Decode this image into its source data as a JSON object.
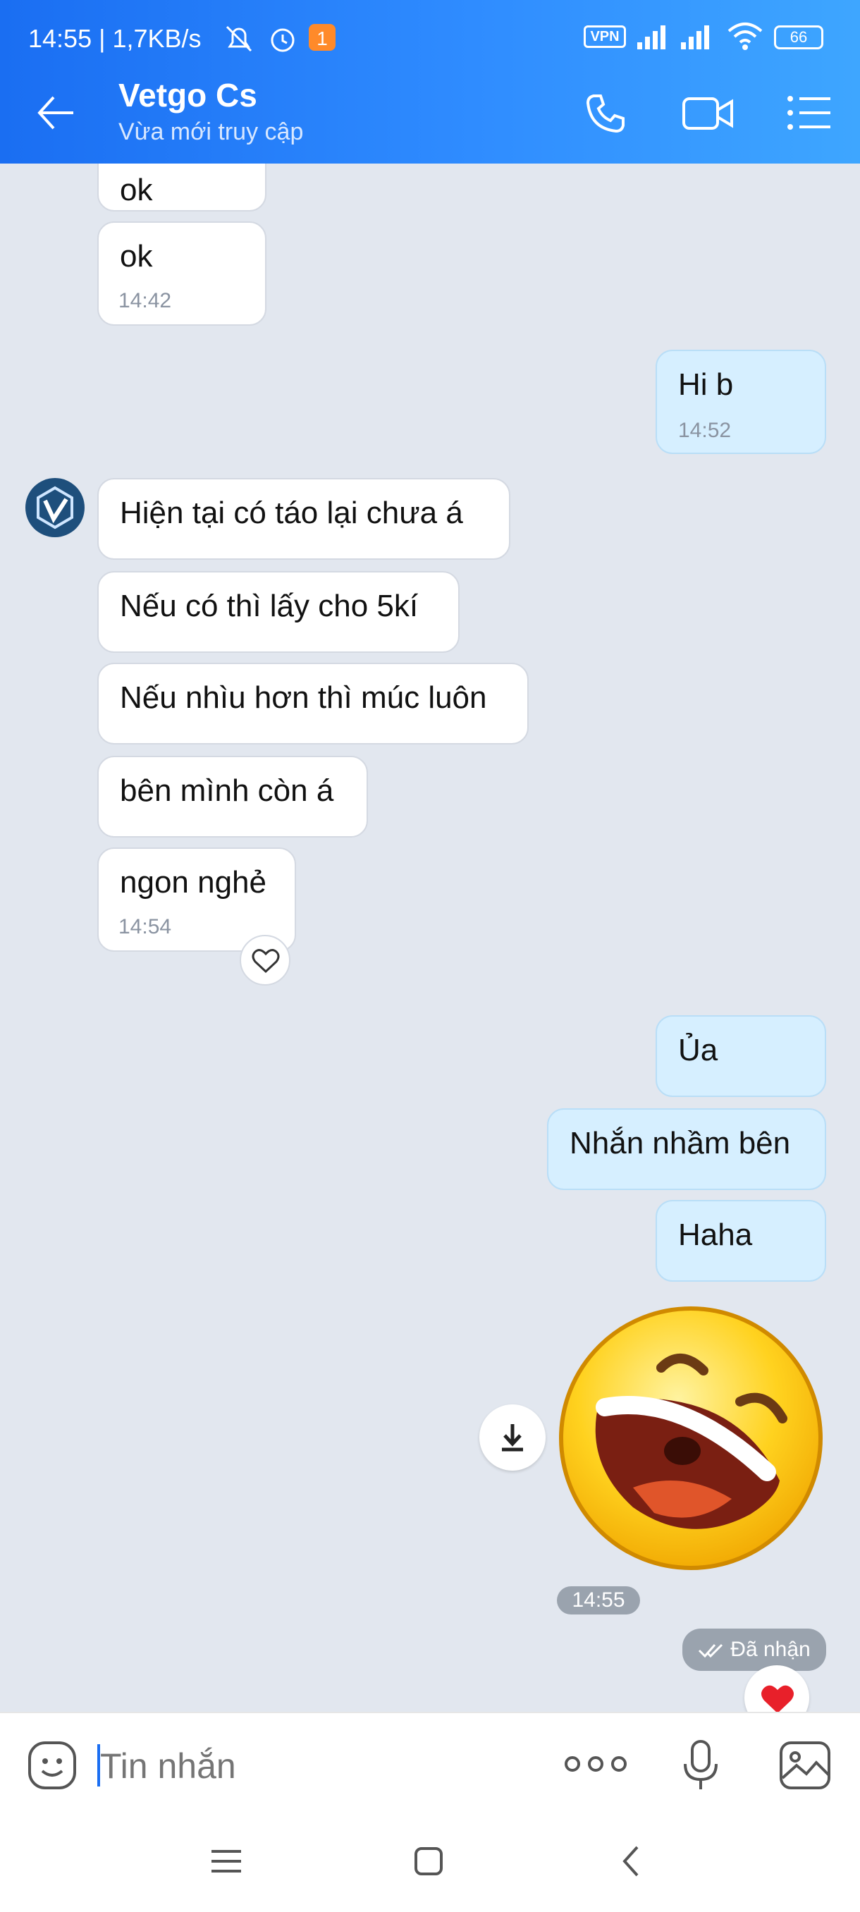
{
  "status_bar": {
    "time_speed": "14:55 | 1,7KB/s",
    "vpn": "VPN",
    "battery": "66"
  },
  "header": {
    "title": "Vetgo Cs",
    "subtitle": "Vừa mới truy cập"
  },
  "messages": {
    "m0": {
      "text": "ok"
    },
    "m1": {
      "text": "ok",
      "time": "14:42"
    },
    "m2": {
      "text": "Hi b",
      "time": "14:52"
    },
    "m3": {
      "text": "Hiện tại có táo lại chưa á"
    },
    "m4": {
      "text": "Nếu có thì lấy cho 5kí"
    },
    "m5": {
      "text": "Nếu nhìu hơn thì múc luôn"
    },
    "m6": {
      "text": "bên mình còn á"
    },
    "m7": {
      "text": "ngon nghẻ",
      "time": "14:54"
    },
    "m8": {
      "text": "Ủa"
    },
    "m9": {
      "text": "Nhắn nhầm bên"
    },
    "m10": {
      "text": "Haha"
    }
  },
  "sticker_time": "14:55",
  "receipt": "Đã nhận",
  "input": {
    "placeholder": "Tin nhắn"
  },
  "colors": {
    "accent": "#1a6ef2",
    "incoming": "#ffffff",
    "outgoing": "#d6efff",
    "chat_bg": "#e2e7ef"
  }
}
